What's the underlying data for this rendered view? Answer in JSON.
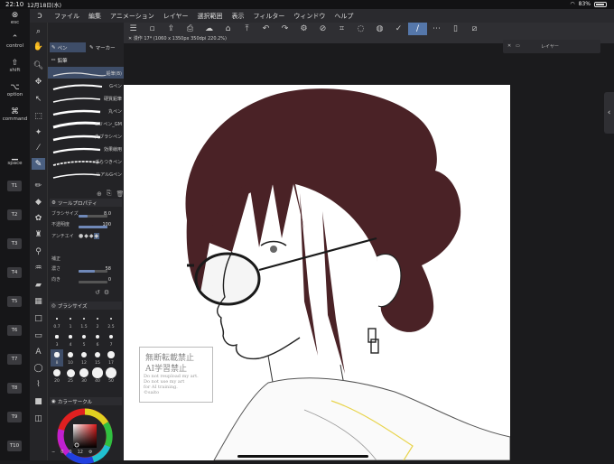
{
  "status_bar": {
    "time": "22:10",
    "date": "12月18日(水)",
    "battery": "83%"
  },
  "menu": {
    "items": [
      "ファイル",
      "編集",
      "アニメーション",
      "レイヤー",
      "選択範囲",
      "表示",
      "フィルター",
      "ウィンドウ",
      "ヘルプ"
    ]
  },
  "modifiers": {
    "esc": "esc",
    "control": "control",
    "shift": "shift",
    "option": "option",
    "command": "command",
    "space": "space",
    "tkeys": [
      "T1",
      "T2",
      "T3",
      "T4",
      "T5",
      "T6",
      "T7",
      "T8",
      "T9",
      "T10"
    ]
  },
  "subtool": {
    "tab_pen": "ペン",
    "tab_marker": "マーカー",
    "group": "鉛筆",
    "brushes": [
      "鉛筆(B)",
      "Gペン",
      "硬質鉛筆",
      "丸ペン",
      "ミリペン_GM",
      "丸ブラシペン",
      "効果線用",
      "ざらつきペン",
      "リアルGペン"
    ],
    "tool_property": "ツールプロパティ",
    "brush_size_label": "ブラシサイズ",
    "brush_size_value": "8.0",
    "opacity_label": "不透明度",
    "opacity_value": "100",
    "antialias_label": "アンチエイ",
    "stabilization_label": "補正",
    "stab1_label": "濃さ",
    "stab1_value": "58",
    "stab2_label": "向き",
    "stab2_value": "0",
    "brush_size_panel": "ブラシサイズ",
    "sizes": [
      "0.7",
      "1",
      "1.5",
      "2",
      "2.5",
      "3",
      "4",
      "5",
      "6",
      "7",
      "8",
      "10",
      "12",
      "15",
      "17",
      "20",
      "25",
      "30",
      "40",
      "50"
    ],
    "color_circle": "カラーサークル",
    "color_values": [
      "0",
      "0",
      "12"
    ]
  },
  "canvas": {
    "tab_title": "漫作 17* (1060 x 1350px 350dpi 220.2%)",
    "layer_label": "レイヤー",
    "watermark": {
      "line1": "無断転載禁止",
      "line2": "AI学習禁止",
      "line3": "Do not reupload my art.",
      "line4": "Do not use my art",
      "line5": "for AI training.",
      "line6": "©saito"
    }
  },
  "colors": {
    "hair": "#4a2226",
    "accent": "#5577aa",
    "earring_line": "#e8d44d"
  }
}
